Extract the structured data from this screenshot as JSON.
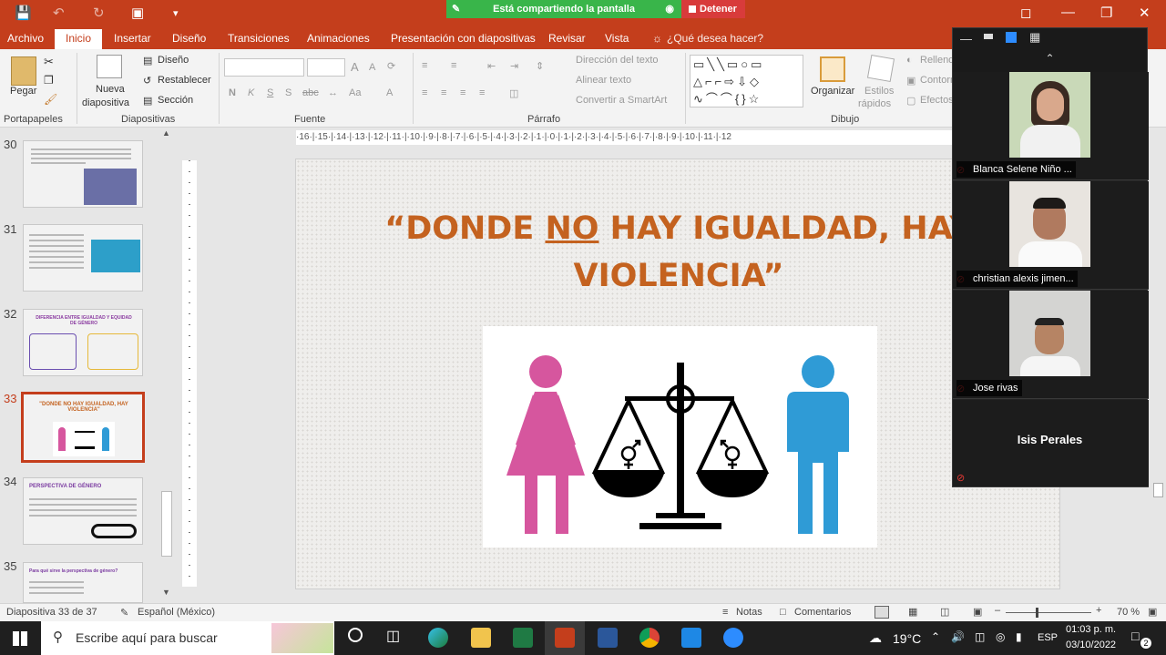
{
  "titlebar": {
    "share_status": "Está compartiendo la pantalla",
    "stop_label": "Detener"
  },
  "tabs": [
    "Archivo",
    "Inicio",
    "Insertar",
    "Diseño",
    "Transiciones",
    "Animaciones",
    "Presentación con diapositivas",
    "Revisar",
    "Vista"
  ],
  "tell_me": "¿Qué desea hacer?",
  "ribbon": {
    "paste": "Pegar",
    "new_slide_line1": "Nueva",
    "new_slide_line2": "diapositiva",
    "layout": "Diseño",
    "reset": "Restablecer",
    "section": "Sección",
    "bold": "N",
    "italic": "K",
    "underline": "S",
    "strike": "S",
    "charspacing": "abc",
    "changecase": "Aa",
    "fontcolor": "A",
    "grow": "A",
    "shrink": "A",
    "text_direction": "Dirección del texto",
    "align_text": "Alinear texto",
    "smartart": "Convertir a SmartArt",
    "arrange": "Organizar",
    "quick_styles_line1": "Estilos",
    "quick_styles_line2": "rápidos",
    "fill": "Relleno",
    "outline": "Contorno",
    "effects": "Efectos",
    "groups": {
      "clipboard": "Portapapeles",
      "slides": "Diapositivas",
      "font": "Fuente",
      "paragraph": "Párrafo",
      "drawing": "Dibujo"
    }
  },
  "ruler_text": "·16·|·15·|·14·|·13·|·12·|·11·|·10·|·9·|·8·|·7·|·6·|·5·|·4·|·3·|·2·|·1·|·0·|·1·|·2·|·3·|·4·|·5·|·6·|·7·|·8·|·9·|·10·|·11·|·12",
  "thumbnails": [
    {
      "num": "30"
    },
    {
      "num": "31"
    },
    {
      "num": "32",
      "title": "DIFERENCIA ENTRE IGUALDAD Y EQUIDAD DE GÉNERO"
    },
    {
      "num": "33",
      "title": "\"DONDE NO HAY IGUALDAD, HAY VIOLENCIA\""
    },
    {
      "num": "34",
      "title": "PERSPECTIVA DE GÉNERO"
    },
    {
      "num": "35",
      "title": "Para qué sirve la perspectiva de género?"
    }
  ],
  "slide": {
    "title_part1": "“DONDE ",
    "title_underlined": "NO",
    "title_part2": " HAY IGUALDAD, HAY",
    "title_line2": "VIOLENCIA”"
  },
  "zoom": {
    "participants": [
      {
        "name": "Blanca Selene Niño ..."
      },
      {
        "name": "christian alexis jimen..."
      },
      {
        "name": "Jose rivas"
      },
      {
        "name": "Isis Perales"
      }
    ]
  },
  "statusbar": {
    "slide_info": "Diapositiva 33 de 37",
    "language": "Español (México)",
    "notes": "Notas",
    "comments": "Comentarios",
    "zoom": "70 %"
  },
  "taskbar": {
    "search_placeholder": "Escribe aquí para buscar",
    "weather": "19°C",
    "lang": "ESP",
    "time": "01:03 p. m.",
    "date": "03/10/2022",
    "notif_count": "2"
  },
  "colors": {
    "accent": "#c43e1c",
    "title_orange": "#c4621f",
    "female_pink": "#d6569e",
    "male_blue": "#2f9bd6"
  }
}
